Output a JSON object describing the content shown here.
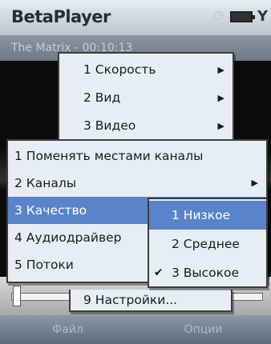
{
  "app": {
    "title": "BetaPlayer"
  },
  "subbar": {
    "text": "The Matrix - 00:10:13"
  },
  "softkeys": {
    "left": "Файл",
    "right": "Опции"
  },
  "menus": {
    "top": [
      {
        "label": "1 Скорость",
        "submenu": true
      },
      {
        "label": "2 Вид",
        "submenu": true
      },
      {
        "label": "3 Видео",
        "submenu": true
      }
    ],
    "main": [
      {
        "label": "1 Поменять местами каналы",
        "submenu": false
      },
      {
        "label": "2 Каналы",
        "submenu": true
      },
      {
        "label": "3 Качество",
        "submenu": true,
        "selected": true
      },
      {
        "label": "4 Аудиодрайвер",
        "submenu": true
      },
      {
        "label": "5 Потоки",
        "submenu": true
      }
    ],
    "bottom": [
      {
        "label": "9 Настройки..."
      }
    ],
    "quality_sub": [
      {
        "label": "1 Низкое",
        "selected": true,
        "checked": false
      },
      {
        "label": "2 Среднее",
        "selected": false,
        "checked": false
      },
      {
        "label": "3 Высокое",
        "selected": false,
        "checked": true
      }
    ]
  },
  "icons": {
    "sync": "sync-icon",
    "battery": "battery-icon",
    "signal": "signal-icon",
    "submenu_arrow": "▶",
    "check": "✔"
  },
  "colors": {
    "selection": "#5a84c9",
    "menu_bg": "#e9edf3",
    "titlebar": "#d5dbe2"
  }
}
